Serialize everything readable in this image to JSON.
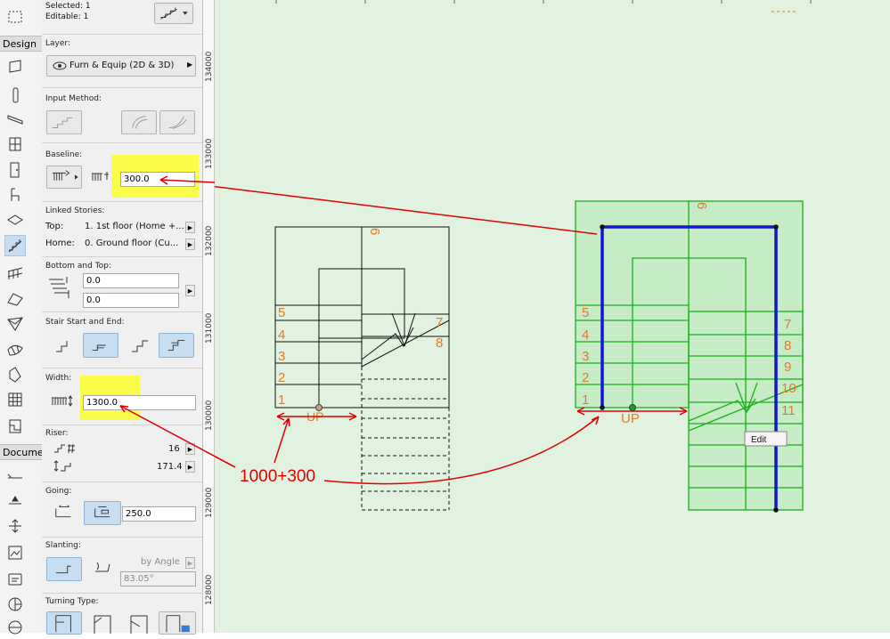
{
  "selection": {
    "selected": "Selected: 1",
    "editable": "Editable: 1"
  },
  "toolbox": {
    "design_label": "Design",
    "document_label": "Documer"
  },
  "layer": {
    "label": "Layer:",
    "value": "Furn & Equip (2D & 3D)"
  },
  "input_method": {
    "label": "Input Method:"
  },
  "baseline": {
    "label": "Baseline:",
    "value": "300.0"
  },
  "linked_stories": {
    "label": "Linked Stories:",
    "top_label": "Top:",
    "top_value": "1. 1st floor (Home +...",
    "home_label": "Home:",
    "home_value": "0. Ground floor (Cu..."
  },
  "bottom_top": {
    "label": "Bottom and Top:",
    "bottom_value": "0.0",
    "top_value": "0.0"
  },
  "stair_start_end": {
    "label": "Stair Start and End:"
  },
  "width": {
    "label": "Width:",
    "value": "1300.0"
  },
  "riser": {
    "label": "Riser:",
    "count": "16",
    "height": "171.4"
  },
  "going": {
    "label": "Going:",
    "value": "250.0"
  },
  "slanting": {
    "label": "Slanting:",
    "mode": "by Angle",
    "angle": "83.05°"
  },
  "turning_type": {
    "label": "Turning Type:"
  },
  "ruler": {
    "ticks": [
      "134000",
      "133000",
      "132000",
      "131000",
      "130000",
      "129000",
      "128000"
    ]
  },
  "drawing": {
    "left_stair": {
      "up_label": "UP",
      "step_numbers": [
        "1",
        "2",
        "3",
        "4",
        "5",
        "6",
        "7",
        "8"
      ]
    },
    "right_stair": {
      "up_label": "UP",
      "step_numbers": [
        "1",
        "2",
        "3",
        "4",
        "5",
        "6",
        "7",
        "8",
        "9",
        "10",
        "11"
      ],
      "edit_label": "Edit"
    },
    "annotation": "1000+300",
    "colors": {
      "annotation": "#e00000",
      "selection": "#1414d4",
      "stair_green": "#17b017",
      "step_numbers": "#e07a2e"
    }
  }
}
